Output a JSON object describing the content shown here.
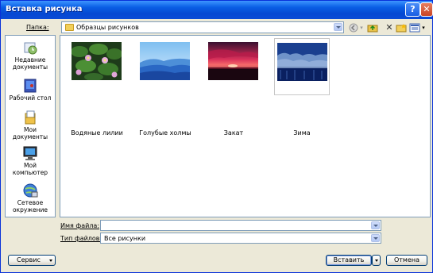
{
  "window": {
    "title": "Вставка рисунка",
    "help": "?",
    "close": "✕"
  },
  "folder_bar": {
    "label": "Папка:",
    "value": "Образцы рисунков"
  },
  "toolbar": {
    "icons": [
      "back-icon",
      "up-folder-icon",
      "delete-icon",
      "new-folder-icon",
      "views-icon"
    ]
  },
  "places": [
    {
      "label": "Недавние документы",
      "icon": "recent-documents-icon"
    },
    {
      "label": "Рабочий стол",
      "icon": "desktop-icon"
    },
    {
      "label": "Мои документы",
      "icon": "my-documents-icon"
    },
    {
      "label": "Мой компьютер",
      "icon": "my-computer-icon"
    },
    {
      "label": "Сетевое окружение",
      "icon": "network-icon"
    }
  ],
  "files": [
    {
      "name": "Водяные лилии",
      "selected": false
    },
    {
      "name": "Голубые холмы",
      "selected": false
    },
    {
      "name": "Закат",
      "selected": false
    },
    {
      "name": "Зима",
      "selected": true
    }
  ],
  "filename": {
    "label": "Имя файла:",
    "value": ""
  },
  "filetype": {
    "label": "Тип файлов:",
    "value": "Все рисунки"
  },
  "buttons": {
    "service": "Сервис",
    "insert": "Вставить",
    "cancel": "Отмена"
  }
}
